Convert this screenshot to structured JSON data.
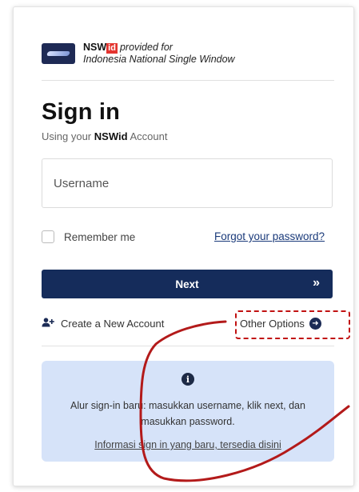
{
  "brand": {
    "nsw": "NSW",
    "id_badge": "id",
    "provided": "provided for",
    "line2": "Indonesia National Single Window"
  },
  "title": "Sign in",
  "subtitle": {
    "prefix": "Using your",
    "strong": "NSWid",
    "suffix": "Account"
  },
  "username": {
    "placeholder": "Username",
    "value": ""
  },
  "remember_label": "Remember me",
  "forgot_label": "Forgot your password?",
  "next_label": "Next",
  "next_chevron": "»",
  "create_label": "Create a New Account",
  "other_label": "Other Options",
  "info": {
    "line1": "Alur sign-in baru: masukkan username, klik next, dan",
    "line2": "masukkan password.",
    "link": "Informasi sign in yang baru, tersedia disini"
  },
  "colors": {
    "primary": "#152c5b",
    "info_bg": "#d6e3f9",
    "annotation": "#b31a1a",
    "badge": "#e3342f"
  }
}
